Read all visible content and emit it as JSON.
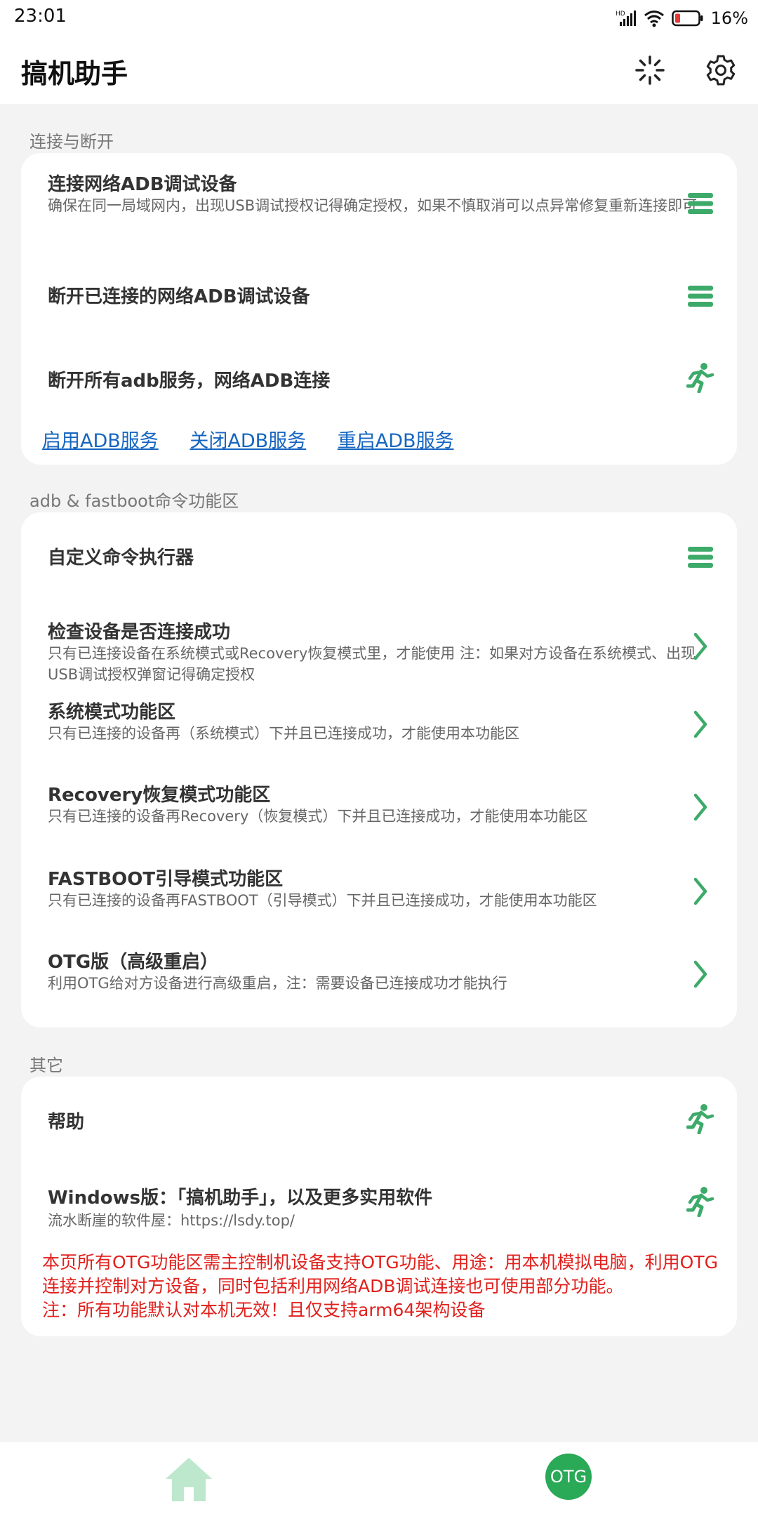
{
  "status": {
    "time": "23:01",
    "battery": "16%",
    "colors": {
      "battery_low": "#e53935"
    }
  },
  "appbar": {
    "title": "搞机助手",
    "icons": [
      "loading-spinner-icon",
      "gear-icon"
    ]
  },
  "colors": {
    "accent": "#3daa6a",
    "link": "#1565c0",
    "warning": "#e0201c"
  },
  "sections": {
    "connect": {
      "label": "连接与断开",
      "items": [
        {
          "title": "连接网络ADB调试设备",
          "subtitle": "确保在同一局域网内，出现USB调试授权记得确定授权，如果不慎取消可以点异常修复重新连接即可",
          "icon": "menu-icon"
        },
        {
          "title": "断开已连接的网络ADB调试设备",
          "icon": "menu-icon"
        },
        {
          "title": "断开所有adb服务，网络ADB连接",
          "icon": "running-person-icon"
        }
      ],
      "links": [
        "启用ADB服务",
        "关闭ADB服务",
        "重启ADB服务"
      ]
    },
    "adb": {
      "label": "adb & fastboot命令功能区",
      "items": [
        {
          "title": "自定义命令执行器",
          "icon": "menu-icon"
        },
        {
          "title": "检查设备是否连接成功",
          "subtitle": "只有已连接设备在系统模式或Recovery恢复模式里，才能使用 注：如果对方设备在系统模式、出现USB调试授权弹窗记得确定授权",
          "icon": "chevron-right-icon"
        },
        {
          "title": "系统模式功能区",
          "subtitle": "只有已连接的设备再（系统模式）下并且已连接成功，才能使用本功能区",
          "icon": "chevron-right-icon"
        },
        {
          "title": "Recovery恢复模式功能区",
          "subtitle": "只有已连接的设备再Recovery（恢复模式）下并且已连接成功，才能使用本功能区",
          "icon": "chevron-right-icon"
        },
        {
          "title": "FASTBOOT引导模式功能区",
          "subtitle": "只有已连接的设备再FASTBOOT（引导模式）下并且已连接成功，才能使用本功能区",
          "icon": "chevron-right-icon"
        },
        {
          "title": "OTG版（高级重启）",
          "subtitle": "利用OTG给对方设备进行高级重启，注：需要设备已连接成功才能执行",
          "icon": "chevron-right-icon"
        }
      ]
    },
    "other": {
      "label": "其它",
      "items": [
        {
          "title": "帮助",
          "icon": "running-person-icon"
        },
        {
          "title": "Windows版：「搞机助手」，以及更多实用软件",
          "subtitle": "流水断崖的软件屋：https://lsdy.top/",
          "icon": "running-person-icon"
        }
      ],
      "warning_lines": [
        "本页所有OTG功能区需主控制机设备支持OTG功能、用途：用本机模拟电脑，利用OTG连接并控制对方设备，同时包括利用网络ADB调试连接也可使用部分功能。",
        "注：所有功能默认对本机无效！且仅支持arm64架构设备"
      ]
    }
  },
  "bottom_nav": {
    "otg_label": "OTG",
    "icons": [
      "home-icon"
    ]
  }
}
